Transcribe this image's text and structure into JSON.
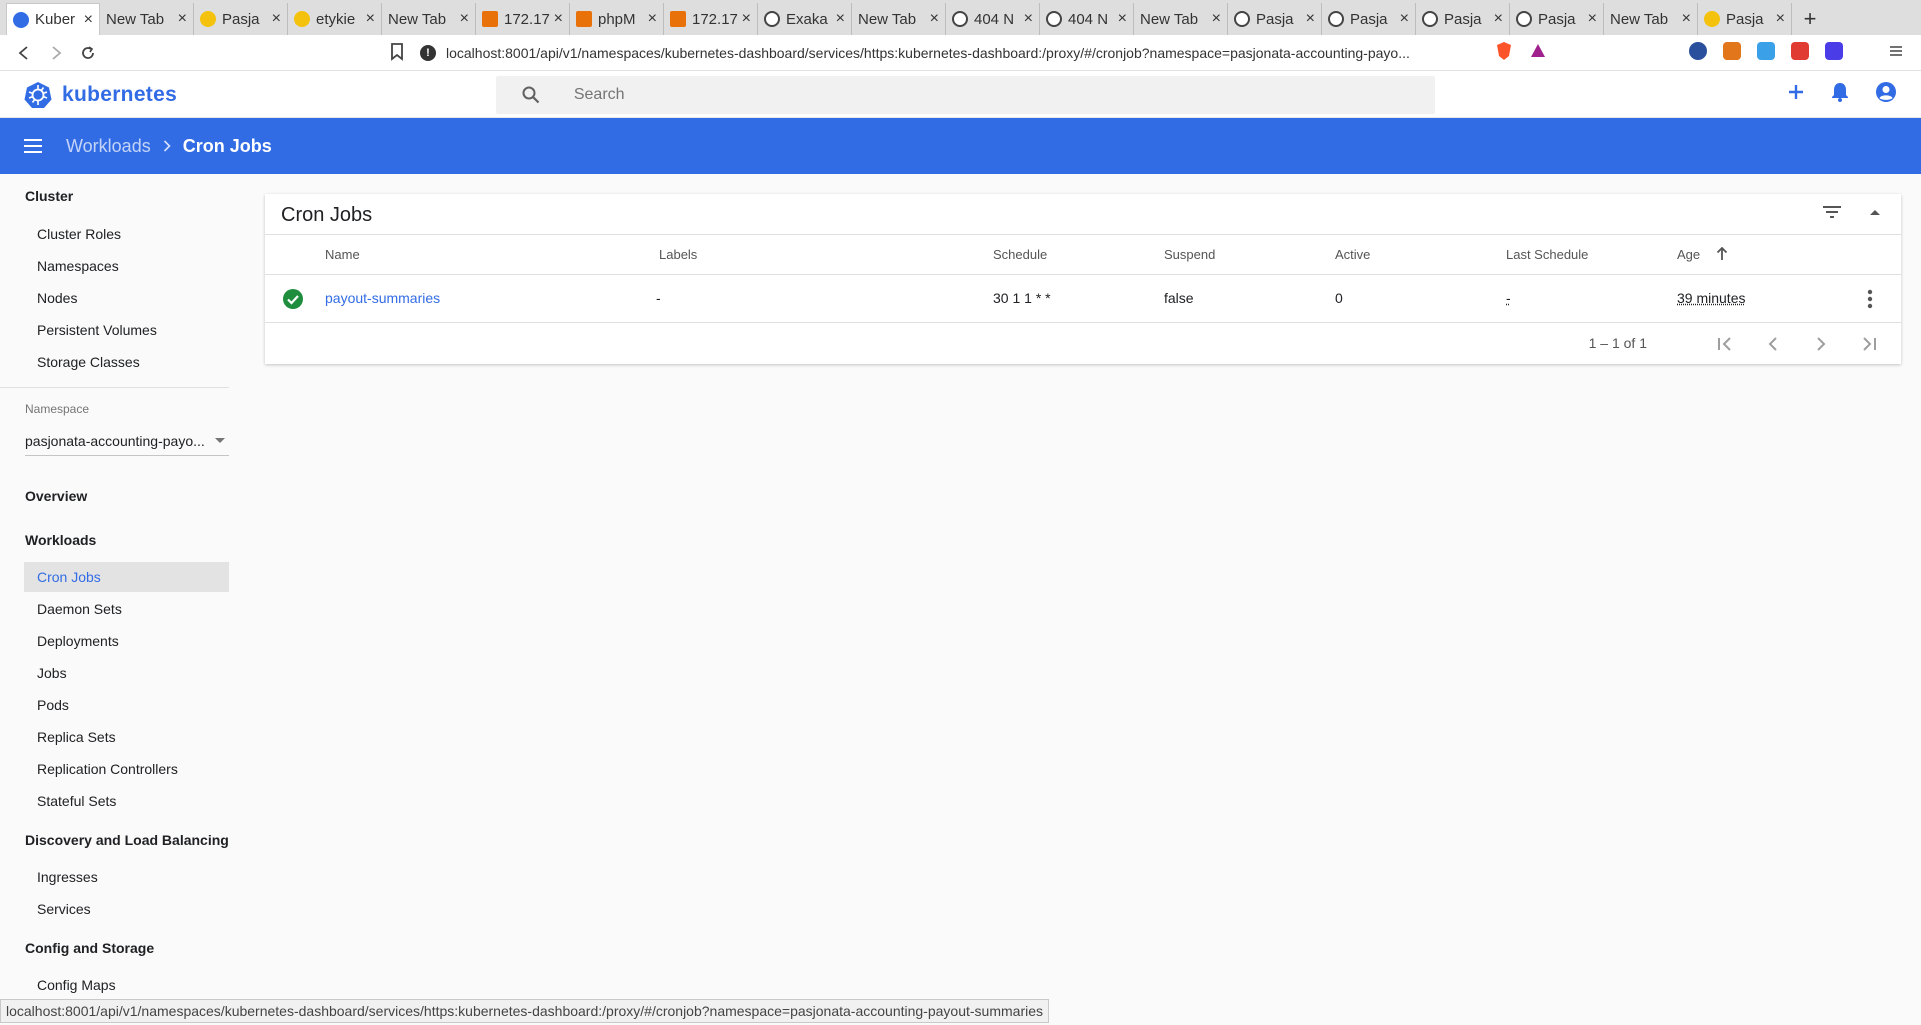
{
  "browser": {
    "tabs": [
      {
        "title": "Kuber",
        "favicon": "k8s",
        "active": true
      },
      {
        "title": "New Tab",
        "favicon": "none"
      },
      {
        "title": "Pasja",
        "favicon": "yellow"
      },
      {
        "title": "etykie",
        "favicon": "yellow"
      },
      {
        "title": "New Tab",
        "favicon": "none"
      },
      {
        "title": "172.17",
        "favicon": "orange"
      },
      {
        "title": "phpM",
        "favicon": "orange"
      },
      {
        "title": "172.17",
        "favicon": "orange"
      },
      {
        "title": "Exaka",
        "favicon": "globe"
      },
      {
        "title": "New Tab",
        "favicon": "none"
      },
      {
        "title": "404 N",
        "favicon": "globe"
      },
      {
        "title": "404 N",
        "favicon": "globe"
      },
      {
        "title": "New Tab",
        "favicon": "none"
      },
      {
        "title": "Pasja",
        "favicon": "globe"
      },
      {
        "title": "Pasja",
        "favicon": "globe"
      },
      {
        "title": "Pasja",
        "favicon": "globe"
      },
      {
        "title": "Pasja",
        "favicon": "globe"
      },
      {
        "title": "New Tab",
        "favicon": "none"
      },
      {
        "title": "Pasja",
        "favicon": "yellow"
      }
    ],
    "url": "localhost:8001/api/v1/namespaces/kubernetes-dashboard/services/https:kubernetes-dashboard:/proxy/#/cronjob?namespace=pasjonata-accounting-payo...",
    "status_url": "localhost:8001/api/v1/namespaces/kubernetes-dashboard/services/https:kubernetes-dashboard:/proxy/#/cronjob?namespace=pasjonata-accounting-payout-summaries"
  },
  "header": {
    "logo_text": "kubernetes",
    "search_placeholder": "Search"
  },
  "toolbar": {
    "breadcrumb_parent": "Workloads",
    "breadcrumb_current": "Cron Jobs"
  },
  "sidebar": {
    "cluster": {
      "title": "Cluster",
      "items": [
        "Cluster Roles",
        "Namespaces",
        "Nodes",
        "Persistent Volumes",
        "Storage Classes"
      ]
    },
    "namespace_label": "Namespace",
    "namespace_value": "pasjonata-accounting-payo...",
    "overview": "Overview",
    "workloads": {
      "title": "Workloads",
      "items": [
        "Cron Jobs",
        "Daemon Sets",
        "Deployments",
        "Jobs",
        "Pods",
        "Replica Sets",
        "Replication Controllers",
        "Stateful Sets"
      ]
    },
    "discovery": {
      "title": "Discovery and Load Balancing",
      "items": [
        "Ingresses",
        "Services"
      ]
    },
    "config": {
      "title": "Config and Storage",
      "items": [
        "Config Maps"
      ]
    }
  },
  "card": {
    "title": "Cron Jobs",
    "columns": {
      "name": "Name",
      "labels": "Labels",
      "schedule": "Schedule",
      "suspend": "Suspend",
      "active": "Active",
      "last_schedule": "Last Schedule",
      "age": "Age"
    },
    "rows": [
      {
        "name": "payout-summaries",
        "labels": "-",
        "schedule": "30 1 1 * *",
        "suspend": "false",
        "active": "0",
        "last_schedule": "-",
        "age": "39 minutes"
      }
    ],
    "range_label": "1 – 1 of 1"
  },
  "colors": {
    "brand": "#326ce5",
    "success": "#1e8e3e"
  }
}
